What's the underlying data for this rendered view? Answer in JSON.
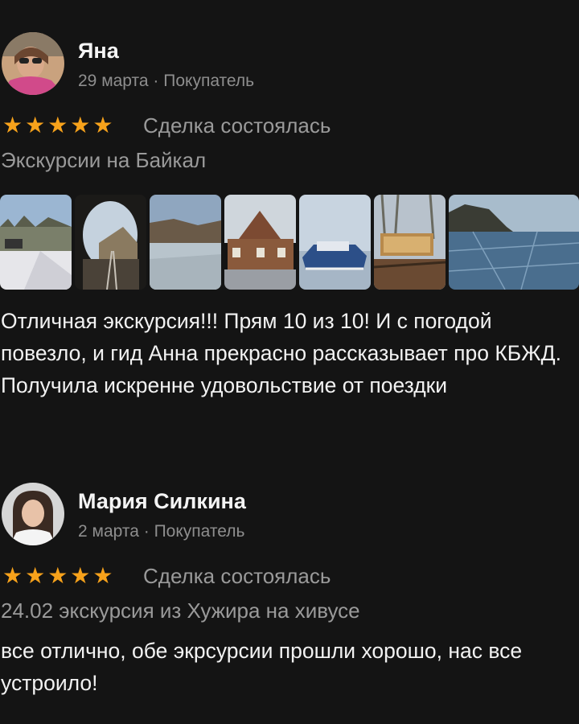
{
  "reviews": [
    {
      "author": "Яна",
      "meta": "29 марта · Покупатель",
      "stars": "★★★★★",
      "rating": 5,
      "status": "Сделка состоялась",
      "product": "Экскурсии на Байкал",
      "photos": [
        "winter-forest-photo",
        "tunnel-rail-photo",
        "frozen-lake-cliff-photo",
        "wooden-station-photo",
        "hovercraft-photo",
        "wooden-sign-photo",
        "baikal-ice-photo"
      ],
      "text": "Отличная экскурсия!!! Прям 10 из 10! И с погодой повезло, и гид Анна прекрасно рассказывает про КБЖД. Получила искренне удовольствие от поездки"
    },
    {
      "author": "Мария Силкина",
      "meta": "2 марта · Покупатель",
      "stars": "★★★★★",
      "rating": 5,
      "status": "Сделка состоялась",
      "product": "24.02 экскурсия из Хужира на хивусе",
      "text": "все отлично,  обе экрсурсии прошли хорошо,  нас все устроило!"
    }
  ],
  "colors": {
    "background": "#141414",
    "star": "#f7a21b",
    "secondary_text": "#9a9a9a"
  }
}
